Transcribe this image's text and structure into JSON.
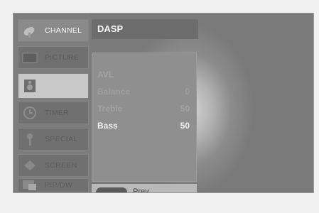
{
  "sidebar": {
    "items": [
      {
        "label": "CHANNEL",
        "icon": "satellite-dish-icon",
        "state": "active"
      },
      {
        "label": "PICTURE",
        "icon": "picture-icon",
        "state": "normal"
      },
      {
        "label": "",
        "icon": "speaker-icon",
        "state": "selected"
      },
      {
        "label": "TIMER",
        "icon": "clock-icon",
        "state": "normal"
      },
      {
        "label": "SPECIAL",
        "icon": "key-icon",
        "state": "normal"
      },
      {
        "label": "SCREEN",
        "icon": "screen-icon",
        "state": "normal"
      },
      {
        "label": "PIP/DW",
        "icon": "pip-icon",
        "state": "normal"
      }
    ]
  },
  "header": {
    "title": "DASP"
  },
  "submenu": {
    "rows": [
      {
        "label": "AVL",
        "value": ""
      },
      {
        "label": "Balance",
        "value": "0"
      },
      {
        "label": "Treble",
        "value": "50"
      },
      {
        "label": "Bass",
        "value": "50"
      }
    ]
  },
  "footer": {
    "prev_label": "Prev."
  },
  "colors": {
    "panel": "#8f8f8f",
    "highlight_text": "#f2f2f2",
    "sidebar": "#7d7d7d"
  }
}
